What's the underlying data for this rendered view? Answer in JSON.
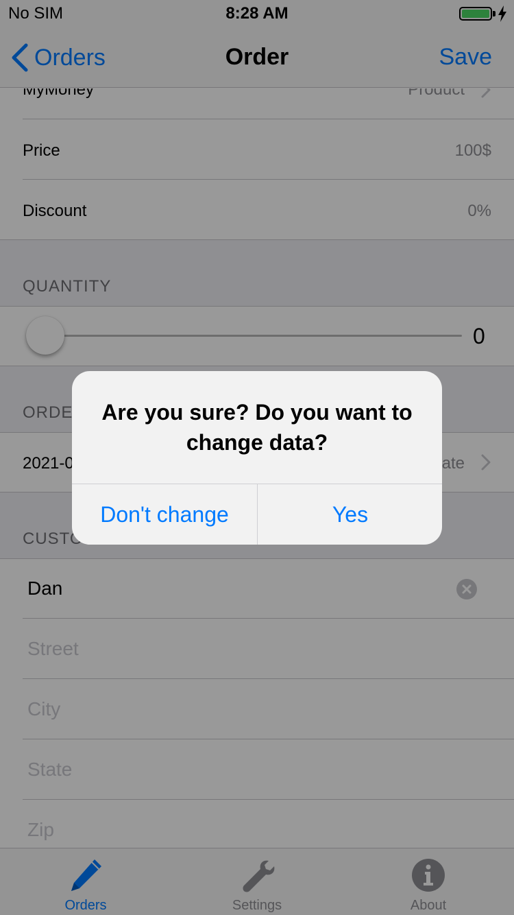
{
  "status_bar": {
    "carrier": "No SIM",
    "time": "8:28 AM"
  },
  "nav": {
    "back_label": "Orders",
    "title": "Order",
    "save_label": "Save"
  },
  "product_row": {
    "label": "MyMoney",
    "value": "Product"
  },
  "price_row": {
    "label": "Price",
    "value": "100$"
  },
  "discount_row": {
    "label": "Discount",
    "value": "0%"
  },
  "quantity_section": {
    "header": "QUANTITY",
    "value": "0"
  },
  "order_section": {
    "header": "ORDE",
    "date": "2021-0",
    "date_value": "ate"
  },
  "customer_section": {
    "header": "CUSTO",
    "name": "Dan",
    "street_placeholder": "Street",
    "city_placeholder": "City",
    "state_placeholder": "State",
    "zip_placeholder": "Zip"
  },
  "tabs": [
    {
      "label": "Orders",
      "icon": "pencil-icon",
      "active": true
    },
    {
      "label": "Settings",
      "icon": "wrench-icon",
      "active": false
    },
    {
      "label": "About",
      "icon": "info-icon",
      "active": false
    }
  ],
  "alert": {
    "message": "Are you sure? Do you want to change data?",
    "cancel_label": "Don't change",
    "confirm_label": "Yes"
  },
  "colors": {
    "accent": "#007aff",
    "battery": "#4cd964",
    "tab_inactive": "#8e8e93"
  }
}
